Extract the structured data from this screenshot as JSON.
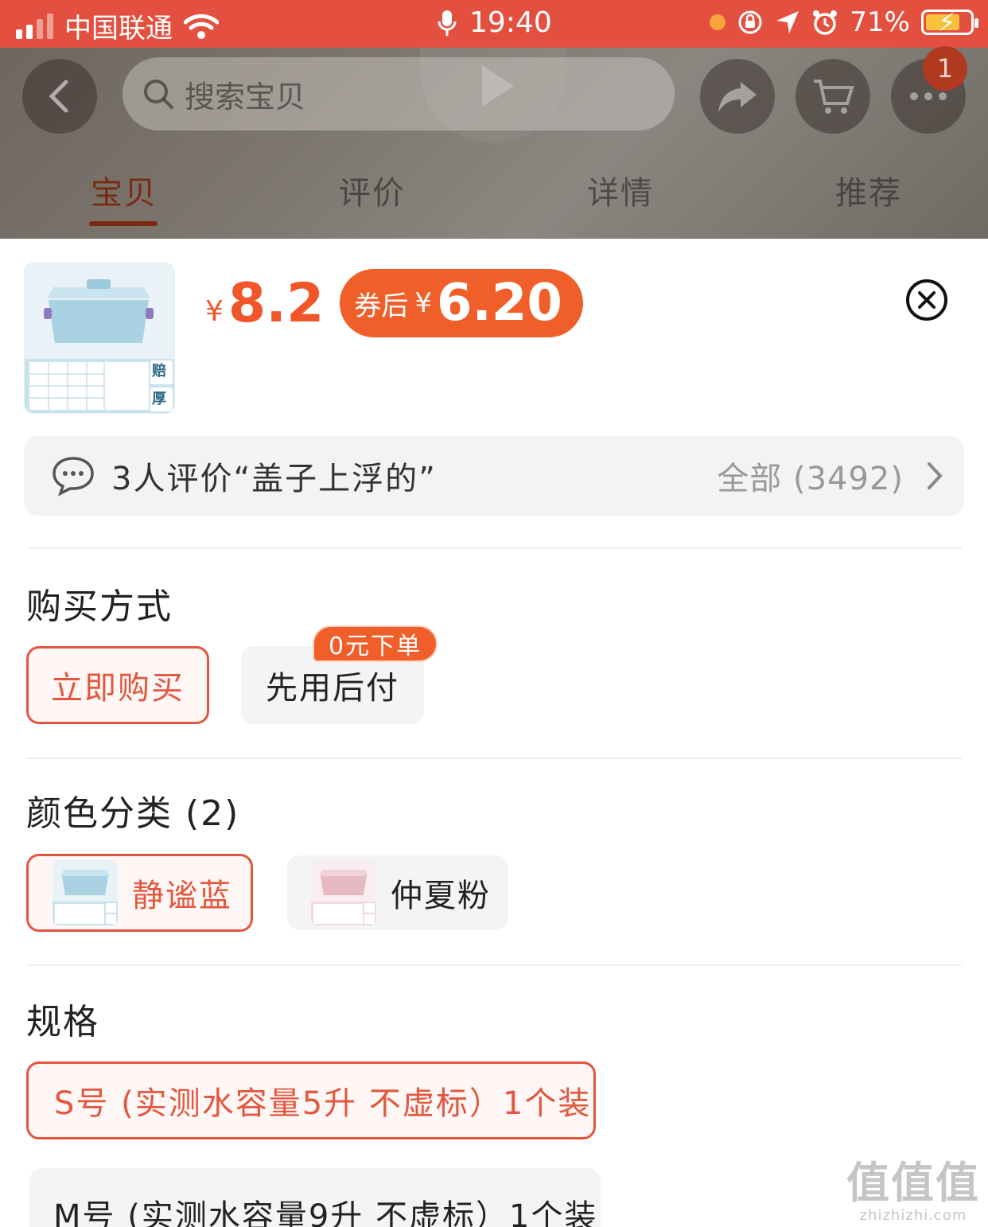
{
  "status_bar": {
    "carrier": "中国联通",
    "time": "19:40",
    "battery": "71%"
  },
  "header": {
    "search_placeholder": "搜索宝贝",
    "cart_count": "1",
    "tabs": [
      {
        "label": "宝贝",
        "active": true
      },
      {
        "label": "评价",
        "active": false
      },
      {
        "label": "详情",
        "active": false
      },
      {
        "label": "推荐",
        "active": false
      }
    ]
  },
  "sku": {
    "currency": "¥",
    "price": "8.2",
    "coupon_label": "券后",
    "coupon_currency": "¥",
    "coupon_price": "6.20",
    "thumb_badges": [
      "赔",
      "厚"
    ]
  },
  "review": {
    "summary": "3人评价“盖子上浮的”",
    "all_label": "全部 (3492)"
  },
  "purchase": {
    "title": "购买方式",
    "options": [
      {
        "label": "立即购买",
        "selected": true
      },
      {
        "label": "先用后付",
        "selected": false,
        "badge": "0元下单"
      }
    ]
  },
  "color": {
    "title": "颜色分类 (2)",
    "options": [
      {
        "label": "静谧蓝",
        "selected": true
      },
      {
        "label": "仲夏粉",
        "selected": false
      }
    ]
  },
  "spec": {
    "title": "规格",
    "options": [
      {
        "label": "S号 (实测水容量5升 不虚标）1个装",
        "selected": true
      },
      {
        "label": "M号 (实测水容量9升 不虚标）1个装",
        "selected": false
      }
    ]
  },
  "watermark": {
    "text": "值值值",
    "site": "zhizhizhi.com"
  },
  "colors": {
    "status_bar": "#e4503f",
    "accent": "#f0562a",
    "selected_border": "#e2573e"
  }
}
